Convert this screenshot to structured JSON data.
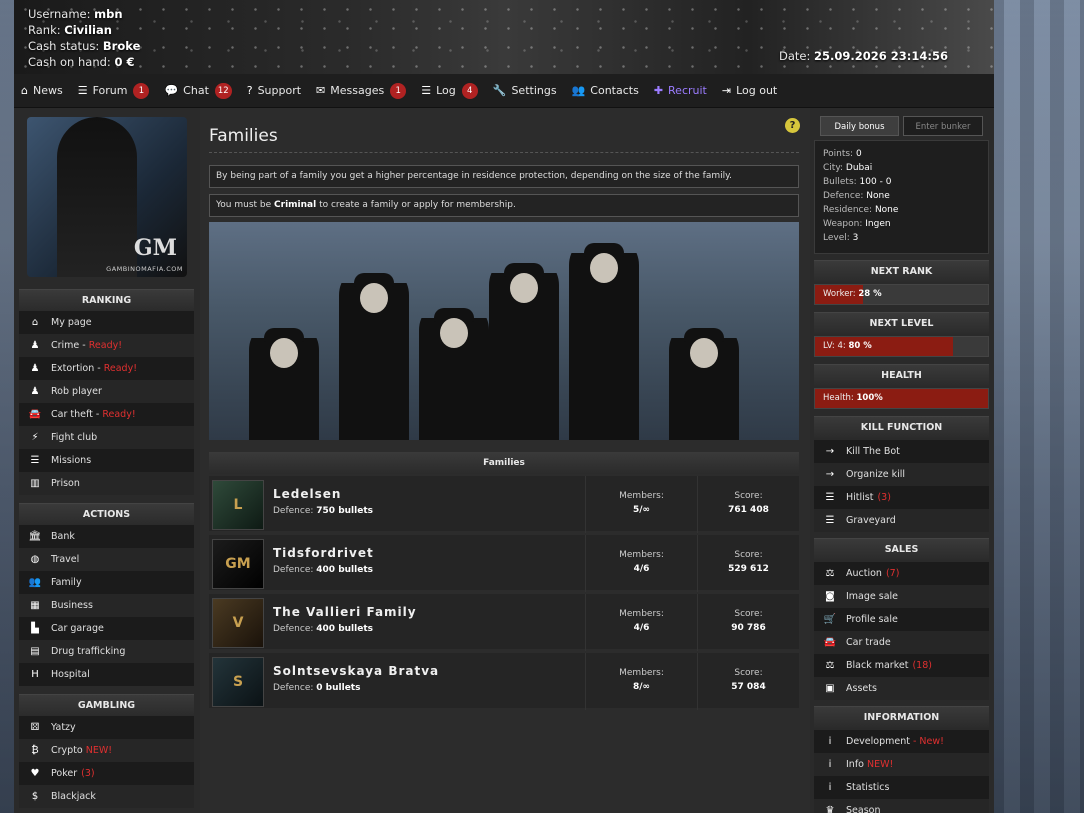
{
  "header": {
    "username_label": "Username:",
    "username": "mbn",
    "rank_label": "Rank:",
    "rank": "Civilian",
    "cash_status_label": "Cash status:",
    "cash_status": "Broke",
    "cash_label": "Cash on hand:",
    "cash": "0 €",
    "date_label": "Date:",
    "date": "25.09.2026 23:14:56"
  },
  "nav": [
    {
      "icon": "home-icon",
      "label": "News"
    },
    {
      "icon": "list-icon",
      "label": "Forum",
      "badge": "1"
    },
    {
      "icon": "chat-icon",
      "label": "Chat",
      "badge": "12"
    },
    {
      "icon": "question-icon",
      "label": "Support"
    },
    {
      "icon": "envelope-icon",
      "label": "Messages",
      "badge": "1"
    },
    {
      "icon": "list-icon",
      "label": "Log",
      "badge": "4"
    },
    {
      "icon": "wrench-icon",
      "label": "Settings"
    },
    {
      "icon": "users-icon",
      "label": "Contacts"
    },
    {
      "icon": "user-plus-icon",
      "label": "Recruit"
    },
    {
      "icon": "sign-out-icon",
      "label": "Log out"
    }
  ],
  "logo": {
    "text": "GM",
    "site": "GAMBINOMAFIA.COM"
  },
  "left": {
    "ranking_title": "RANKING",
    "ranking": [
      {
        "icon": "home-icon",
        "label": "My page"
      },
      {
        "icon": "person-icon",
        "label": "Crime -",
        "status": "Ready!"
      },
      {
        "icon": "person-icon",
        "label": "Extortion -",
        "status": "Ready!"
      },
      {
        "icon": "person-icon",
        "label": "Rob player"
      },
      {
        "icon": "car-icon",
        "label": "Car theft -",
        "status": "Ready!"
      },
      {
        "icon": "bolt-icon",
        "label": "Fight club"
      },
      {
        "icon": "list-icon",
        "label": "Missions"
      },
      {
        "icon": "prison-icon",
        "label": "Prison"
      }
    ],
    "actions_title": "ACTIONS",
    "actions": [
      {
        "icon": "bank-icon",
        "label": "Bank"
      },
      {
        "icon": "globe-icon",
        "label": "Travel"
      },
      {
        "icon": "users-icon",
        "label": "Family"
      },
      {
        "icon": "building-icon",
        "label": "Business"
      },
      {
        "icon": "garage-icon",
        "label": "Car garage"
      },
      {
        "icon": "drugs-icon",
        "label": "Drug trafficking"
      },
      {
        "icon": "hospital-icon",
        "label": "Hospital"
      }
    ],
    "gambling_title": "GAMBLING",
    "gambling": [
      {
        "icon": "dice-icon",
        "label": "Yatzy"
      },
      {
        "icon": "bitcoin-icon",
        "label": "Crypto",
        "new": "NEW!"
      },
      {
        "icon": "heart-icon",
        "label": "Poker",
        "count": "(3)"
      },
      {
        "icon": "dollar-icon",
        "label": "Blackjack"
      }
    ]
  },
  "main": {
    "title": "Families",
    "help": "?",
    "info1": "By being part of a family you get a higher percentage in residence protection, depending on the size of the family.",
    "info2_pre": "You must be ",
    "info2_bold": "Criminal",
    "info2_post": " to create a family or apply for membership.",
    "families_title": "Families",
    "members_label": "Members:",
    "score_label": "Score:",
    "defence_label": "Defence:",
    "families": [
      {
        "name": "Ledelsen",
        "defence": "750 bullets",
        "members": "5/∞",
        "score": "761 408",
        "thumb": "L"
      },
      {
        "name": "Tidsfordrivet",
        "defence": "400 bullets",
        "members": "4/6",
        "score": "529 612",
        "thumb": "GM"
      },
      {
        "name": "The Vallieri Family",
        "defence": "400 bullets",
        "members": "4/6",
        "score": "90 786",
        "thumb": "V"
      },
      {
        "name": "Solntsevskaya Bratva",
        "defence": "0 bullets",
        "members": "8/∞",
        "score": "57 084",
        "thumb": "S"
      }
    ]
  },
  "right": {
    "tab_daily": "Daily bonus",
    "tab_bunker": "Enter bunker",
    "stats": [
      {
        "label": "Points:",
        "value": "0"
      },
      {
        "label": "City:",
        "value": "Dubai"
      },
      {
        "label": "Bullets:",
        "value": "100 - 0"
      },
      {
        "label": "Defence:",
        "value": "None"
      },
      {
        "label": "Residence:",
        "value": "None"
      },
      {
        "label": "Weapon:",
        "value": "Ingen"
      },
      {
        "label": "Level:",
        "value": "3"
      }
    ],
    "next_rank_title": "NEXT RANK",
    "next_rank_label": "Worker:",
    "next_rank_value": "28 %",
    "next_rank_pct": 28,
    "next_level_title": "NEXT LEVEL",
    "next_level_label": "LV: 4:",
    "next_level_value": "80 %",
    "next_level_pct": 80,
    "health_title": "HEALTH",
    "health_label": "Health:",
    "health_value": "100%",
    "health_pct": 100,
    "kill_title": "KILL FUNCTION",
    "kill": [
      {
        "icon": "arrow-right-icon",
        "label": "Kill The Bot"
      },
      {
        "icon": "arrow-right-icon",
        "label": "Organize kill"
      },
      {
        "icon": "list-icon",
        "label": "Hitlist",
        "count": "(3)"
      },
      {
        "icon": "list-icon",
        "label": "Graveyard"
      }
    ],
    "sales_title": "SALES",
    "sales": [
      {
        "icon": "scale-icon",
        "label": "Auction",
        "count": "(7)"
      },
      {
        "icon": "camera-icon",
        "label": "Image sale"
      },
      {
        "icon": "cart-icon",
        "label": "Profile sale"
      },
      {
        "icon": "car-icon",
        "label": "Car trade"
      },
      {
        "icon": "scale-icon",
        "label": "Black market",
        "count": "(18)"
      },
      {
        "icon": "box-icon",
        "label": "Assets"
      }
    ],
    "info_title": "INFORMATION",
    "info": [
      {
        "icon": "info-icon",
        "label": "Development",
        "new": "- New!"
      },
      {
        "icon": "info-icon",
        "label": "Info",
        "new": "NEW!"
      },
      {
        "icon": "info-icon",
        "label": "Statistics"
      },
      {
        "icon": "trophy-icon",
        "label": "Season"
      }
    ]
  }
}
